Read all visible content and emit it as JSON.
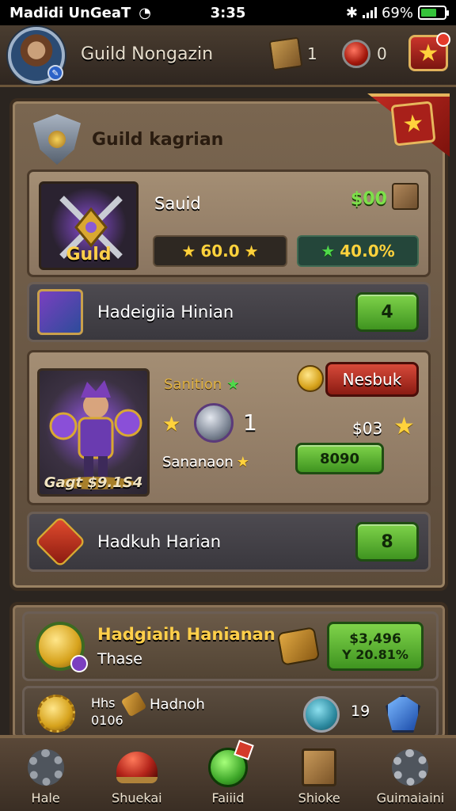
{
  "status_bar": {
    "carrier": "Madidi UnGeaT",
    "time": "3:35",
    "battery": "69%",
    "battery_level": 0.69
  },
  "header": {
    "title": "Guild Nongazin",
    "resources": [
      {
        "icon": "crate-icon",
        "value": "1"
      },
      {
        "icon": "red-gem-icon",
        "value": "0"
      }
    ],
    "favorite_icon": "star-icon"
  },
  "panel": {
    "title": "Guild kagrian",
    "featured": {
      "portrait_label": "Guld",
      "name": "Sauid",
      "price": "$00",
      "stat_gold": "60.0",
      "stat_green": "40.0%"
    },
    "row1": {
      "label": "Hadeigiia Hinian",
      "button": "4"
    },
    "hero": {
      "caption": "Gagt $9.1S4",
      "stat_top": "Sanition",
      "level": "1",
      "stat_bottom": "Sananaon",
      "action_button": "Nesbuk",
      "price": "$03",
      "buy_button": "8090"
    },
    "row2": {
      "label": "Hadkuh Harian",
      "button": "8"
    }
  },
  "panel2": {
    "row1": {
      "title": "Hadgiaih Hanianan",
      "subtitle": "Thase",
      "price_line1": "$3,496",
      "price_line2": "Y 20.81%"
    },
    "row2": {
      "line1": "Hhs",
      "line2": "0106",
      "label": "Hadnoh",
      "count": "19"
    }
  },
  "bottom_nav": [
    {
      "label": "Hale",
      "icon": "gear-icon"
    },
    {
      "label": "Shuekai",
      "icon": "helmet-icon"
    },
    {
      "label": "Faiiid",
      "icon": "green-orb-icon"
    },
    {
      "label": "Shioke",
      "icon": "scroll-icon"
    },
    {
      "label": "Guimaiaini",
      "icon": "cog-icon"
    }
  ],
  "colors": {
    "accent_green": "#4fa629",
    "accent_red": "#c0281f",
    "gold": "#ffd23c",
    "panel_brown": "#6e5b47"
  }
}
